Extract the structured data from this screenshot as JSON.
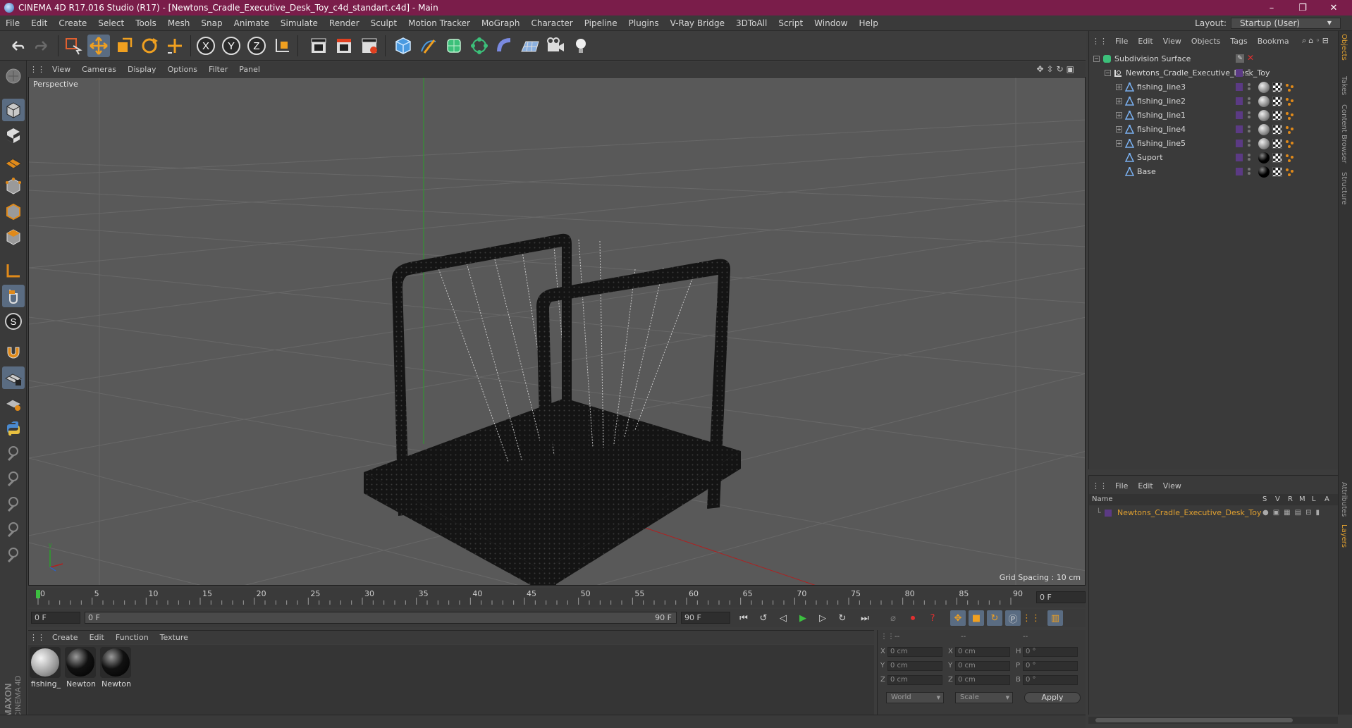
{
  "window": {
    "title": "CINEMA 4D R17.016 Studio (R17) - [Newtons_Cradle_Executive_Desk_Toy_c4d_standart.c4d] - Main",
    "min": "–",
    "max": "❐",
    "close": "✕"
  },
  "menu": [
    "File",
    "Edit",
    "Create",
    "Select",
    "Tools",
    "Mesh",
    "Snap",
    "Animate",
    "Simulate",
    "Render",
    "Sculpt",
    "Motion Tracker",
    "MoGraph",
    "Character",
    "Pipeline",
    "Plugins",
    "V-Ray Bridge",
    "3DToAll",
    "Script",
    "Window",
    "Help"
  ],
  "layout": {
    "label": "Layout:",
    "value": "Startup (User)"
  },
  "viewport": {
    "menu": [
      "View",
      "Cameras",
      "Display",
      "Options",
      "Filter",
      "Panel"
    ],
    "label": "Perspective",
    "grid_spacing": "Grid Spacing : 10 cm"
  },
  "timeline": {
    "ticks": [
      "0",
      "5",
      "10",
      "15",
      "20",
      "25",
      "30",
      "35",
      "40",
      "45",
      "50",
      "55",
      "60",
      "65",
      "70",
      "75",
      "80",
      "85",
      "90"
    ],
    "current_frame": "0 F"
  },
  "transport": {
    "start": "0 F",
    "range_start": "0 F",
    "range_end": "90 F",
    "end": "90 F"
  },
  "materials": {
    "menu": [
      "Create",
      "Edit",
      "Function",
      "Texture"
    ],
    "items": [
      {
        "name": "fishing_",
        "kind": "wire"
      },
      {
        "name": "Newton",
        "kind": "black"
      },
      {
        "name": "Newton",
        "kind": "black"
      }
    ]
  },
  "coords": {
    "headers": [
      "--",
      "--",
      "--"
    ],
    "rows": [
      {
        "a": "X",
        "av": "0 cm",
        "b": "X",
        "bv": "0 cm",
        "c": "H",
        "cv": "0 °"
      },
      {
        "a": "Y",
        "av": "0 cm",
        "b": "Y",
        "bv": "0 cm",
        "c": "P",
        "cv": "0 °"
      },
      {
        "a": "Z",
        "av": "0 cm",
        "b": "Z",
        "bv": "0 cm",
        "c": "B",
        "cv": "0 °"
      }
    ],
    "mode1": "World",
    "mode2": "Scale",
    "apply": "Apply"
  },
  "objects": {
    "menu": [
      "File",
      "Edit",
      "View",
      "Objects",
      "Tags",
      "Bookma"
    ],
    "items": [
      {
        "name": "Subdivision Surface",
        "depth": 0,
        "icon": "subdivision-icon",
        "expand": "−"
      },
      {
        "name": "Newtons_Cradle_Executive_Desk_Toy",
        "depth": 1,
        "icon": "null-icon",
        "expand": "−"
      },
      {
        "name": "fishing_line3",
        "depth": 2,
        "icon": "polygon-icon",
        "expand": "+",
        "tag": "wire"
      },
      {
        "name": "fishing_line2",
        "depth": 2,
        "icon": "polygon-icon",
        "expand": "+",
        "tag": "wire"
      },
      {
        "name": "fishing_line1",
        "depth": 2,
        "icon": "polygon-icon",
        "expand": "+",
        "tag": "wire"
      },
      {
        "name": "fishing_line4",
        "depth": 2,
        "icon": "polygon-icon",
        "expand": "+",
        "tag": "wire"
      },
      {
        "name": "fishing_line5",
        "depth": 2,
        "icon": "polygon-icon",
        "expand": "+",
        "tag": "wire"
      },
      {
        "name": "Suport",
        "depth": 2,
        "icon": "polygon-icon",
        "expand": "",
        "tag": "black"
      },
      {
        "name": "Base",
        "depth": 2,
        "icon": "polygon-icon",
        "expand": "",
        "tag": "black"
      }
    ]
  },
  "layers": {
    "menu": [
      "File",
      "Edit",
      "View"
    ],
    "header": {
      "name": "Name",
      "cols": [
        "S",
        "V",
        "R",
        "M",
        "L",
        "A"
      ]
    },
    "items": [
      {
        "name": "Newtons_Cradle_Executive_Desk_Toy"
      }
    ]
  },
  "side_tabs": [
    "Objects",
    "Takes",
    "Content Browser",
    "Structure",
    "Attributes",
    "Layers"
  ],
  "colors": {
    "title_bar": "#7a1d4a",
    "accent": "#5a6c82",
    "layer_text": "#e0a030",
    "layer_color": "#5b3a84"
  }
}
